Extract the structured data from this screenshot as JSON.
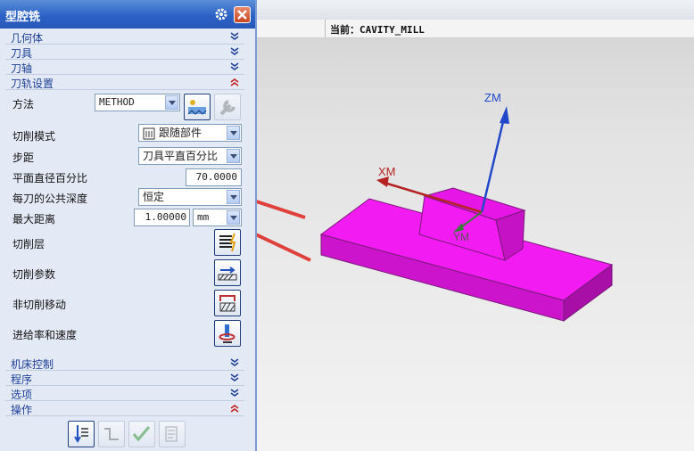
{
  "dialog": {
    "title": "型腔铣",
    "sections": {
      "geometry": "几何体",
      "tool": "刀具",
      "tool_axis": "刀轴",
      "path_settings": "刀轨设置",
      "machine_control": "机床控制",
      "program": "程序",
      "options": "选项",
      "actions": "操作"
    },
    "path": {
      "method_label": "方法",
      "method_value": "METHOD",
      "cut_pattern_label": "切削模式",
      "cut_pattern_value": "跟随部件",
      "stepover_label": "步距",
      "stepover_value": "刀具平直百分比",
      "flat_percent_label": "平面直径百分比",
      "flat_percent_value": "70.0000",
      "common_depth_label": "每刀的公共深度",
      "common_depth_value": "恒定",
      "max_distance_label": "最大距离",
      "max_distance_value": "1.00000",
      "max_distance_unit": "mm",
      "cut_levels_label": "切削层",
      "cut_params_label": "切削参数",
      "non_cut_moves_label": "非切削移动",
      "feeds_speeds_label": "进给率和速度"
    }
  },
  "viewport": {
    "breadcrumb": "当前：CAVITY_MILL",
    "axes": {
      "zm": "ZM",
      "xm": "XM",
      "ym": "YM"
    }
  },
  "colors": {
    "part": "#f21bf2",
    "title_bar": "#2d62c6",
    "section_text": "#1d3f96",
    "annotation_arrow": "#e0403c"
  }
}
